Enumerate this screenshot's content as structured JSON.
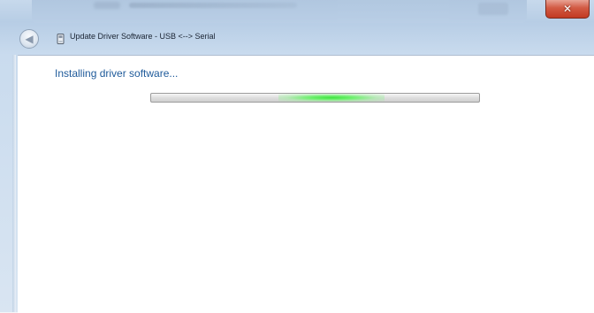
{
  "window": {
    "title": "Update Driver Software - USB <--> Serial",
    "close_glyph": "✕",
    "back_glyph": "◀",
    "icons": [
      "back-arrow-icon",
      "usb-device-icon",
      "close-icon"
    ]
  },
  "content": {
    "heading": "Installing driver software..."
  },
  "progress": {
    "mode": "indeterminate-marquee",
    "marquee_position_fraction": 0.55,
    "color": "#3ee23e"
  },
  "colors": {
    "heading": "#1e5a9a",
    "titlebar": "#c7d9ec",
    "close_button": "#c23a22"
  }
}
